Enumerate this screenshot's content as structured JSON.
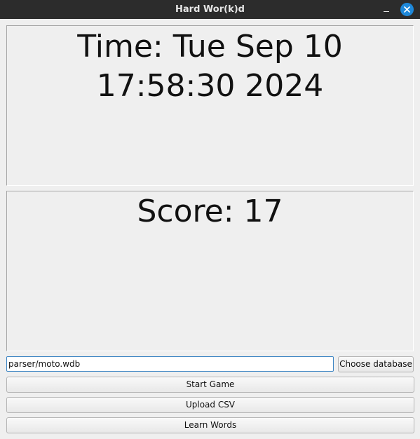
{
  "window": {
    "title": "Hard Wor(k)d",
    "minimize_icon": "minimize-icon",
    "close_icon": "close-icon",
    "accent_color": "#1e88d9"
  },
  "time_display": {
    "text": "Time: Tue Sep 10 17:58:30 2024"
  },
  "score_display": {
    "text": "Score: 17"
  },
  "database": {
    "path_value": "parser/moto.wdb",
    "choose_label": "Choose database"
  },
  "actions": {
    "start_label": "Start Game",
    "upload_label": "Upload CSV",
    "learn_label": "Learn Words"
  }
}
